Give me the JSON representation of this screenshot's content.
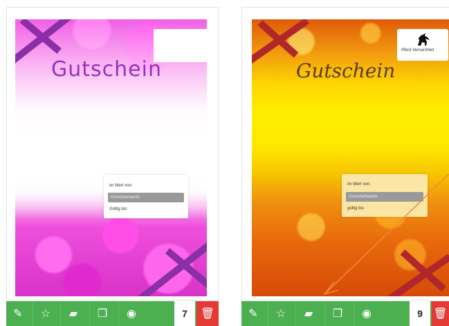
{
  "cards": [
    {
      "title": "Gutschein",
      "theme": "pink-flowers",
      "value_label": "im Wert von:",
      "value_field": "Gutscheinwerte",
      "valid_label": "Gültig bis:",
      "count": "7",
      "accent": "#9a2fbf"
    },
    {
      "title": "Gutschein",
      "theme": "gold-stars",
      "logo_text": "Pferd Vernarrtheit",
      "value_label": "im Wert von:",
      "value_field": "Gutscheinwerte",
      "valid_label": "gültig bis:",
      "count": "9",
      "accent": "#5a3a20"
    }
  ],
  "toolbar": {
    "color": "#4caf50",
    "delete_color": "#e53935",
    "buttons": [
      {
        "name": "edit-icon",
        "glyph": "✎"
      },
      {
        "name": "star-icon",
        "glyph": "☆"
      },
      {
        "name": "folder-icon",
        "glyph": "▰"
      },
      {
        "name": "duplicate-icon",
        "glyph": "❐"
      },
      {
        "name": "eye-icon",
        "glyph": "◉"
      }
    ],
    "delete_glyph": "🗑"
  }
}
